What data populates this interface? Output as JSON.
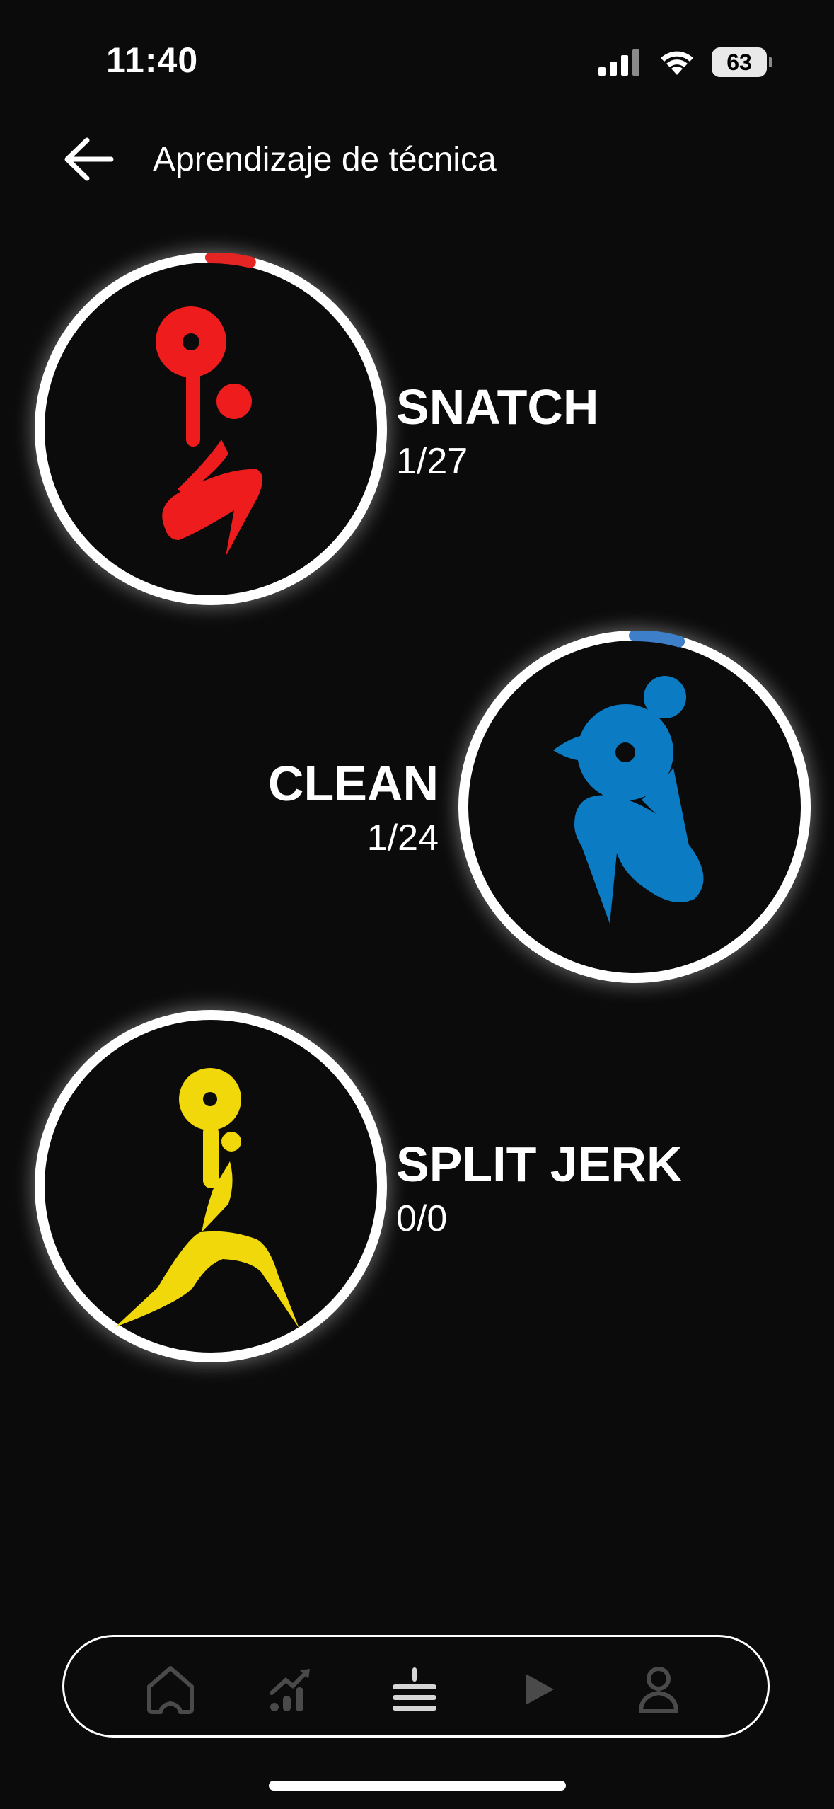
{
  "status": {
    "time": "11:40",
    "battery": "63"
  },
  "header": {
    "title": "Aprendizaje de técnica",
    "back_icon": "arrow-left-icon"
  },
  "lifts": [
    {
      "name": "SNATCH",
      "count": "1/27",
      "color": "#ee1c1c",
      "progress_color": "#e52424",
      "progress": 0.037
    },
    {
      "name": "CLEAN",
      "count": "1/24",
      "color": "#0b7bc4",
      "progress_color": "#3d7fc9",
      "progress": 0.042
    },
    {
      "name": "SPLIT JERK",
      "count": "0/0",
      "color": "#f0d80a",
      "progress_color": "#f0d80a",
      "progress": 0
    }
  ],
  "nav": {
    "items": [
      "home-icon",
      "stats-icon",
      "barbell-icon",
      "play-icon",
      "profile-icon"
    ],
    "active_index": 2,
    "inactive_color": "#4a4a4a",
    "active_color": "#d6d6d6"
  }
}
